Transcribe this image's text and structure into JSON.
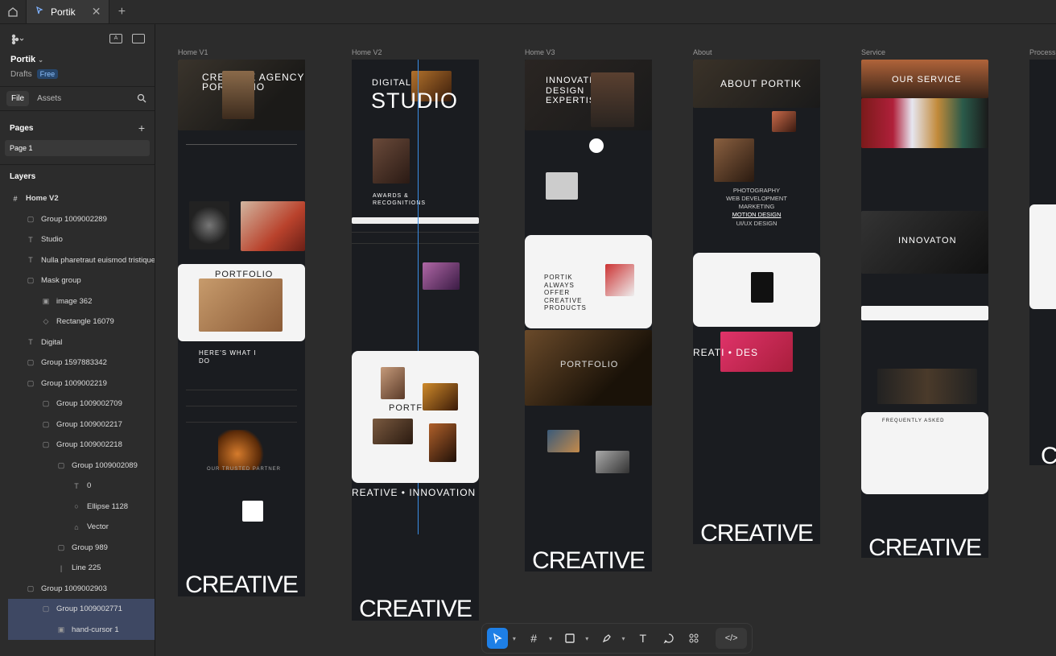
{
  "topbar": {
    "tab_title": "Portik"
  },
  "sidebar": {
    "file_name": "Portik",
    "drafts_label": "Drafts",
    "plan_badge": "Free",
    "tabs": {
      "file": "File",
      "assets": "Assets"
    },
    "pages_title": "Pages",
    "pages": [
      "Page 1"
    ],
    "layers_title": "Layers",
    "layers": [
      {
        "label": "Home V2",
        "icon": "frame-icon",
        "indent": 0
      },
      {
        "label": "Group 1009002289",
        "icon": "group-icon",
        "indent": 1
      },
      {
        "label": "Studio",
        "icon": "text-icon",
        "indent": 1
      },
      {
        "label": "Nulla pharetraut euismod tristique",
        "icon": "text-icon",
        "indent": 1
      },
      {
        "label": "Mask group",
        "icon": "group-icon",
        "indent": 1
      },
      {
        "label": "image 362",
        "icon": "image-icon",
        "indent": 2
      },
      {
        "label": "Rectangle 16079",
        "icon": "rectangle-icon",
        "indent": 2
      },
      {
        "label": "Digital",
        "icon": "text-icon",
        "indent": 1
      },
      {
        "label": "Group 1597883342",
        "icon": "group-icon",
        "indent": 1
      },
      {
        "label": "Group 1009002219",
        "icon": "group-icon",
        "indent": 1
      },
      {
        "label": "Group 1009002709",
        "icon": "group-icon",
        "indent": 2
      },
      {
        "label": "Group 1009002217",
        "icon": "group-icon",
        "indent": 2
      },
      {
        "label": "Group 1009002218",
        "icon": "group-icon",
        "indent": 2
      },
      {
        "label": "Group 1009002089",
        "icon": "group-icon",
        "indent": 3
      },
      {
        "label": "0",
        "icon": "text-icon",
        "indent": 4
      },
      {
        "label": "Ellipse 1128",
        "icon": "ellipse-icon",
        "indent": 4
      },
      {
        "label": "Vector",
        "icon": "vector-icon",
        "indent": 4
      },
      {
        "label": "Group 989",
        "icon": "group-icon",
        "indent": 3
      },
      {
        "label": "Line 225",
        "icon": "line-icon",
        "indent": 3
      },
      {
        "label": "Group 1009002903",
        "icon": "group-icon",
        "indent": 1
      },
      {
        "label": "Group 1009002771",
        "icon": "group-icon",
        "indent": 2,
        "selected": true
      },
      {
        "label": "hand-cursor 1",
        "icon": "image-icon",
        "indent": 3,
        "selected": true
      }
    ]
  },
  "canvas": {
    "frames": [
      {
        "label": "Home V1",
        "hero": "CREATIVE AGENCY PORTFOLIO",
        "card": "PORTFOLIO",
        "section": "HERE'S WHAT I DO",
        "trusted": "OUR TRUSTED PARTNER",
        "footer_word": "CREATIVE"
      },
      {
        "label": "Home V2",
        "hero": "STUDIO",
        "hero_top": "DIGITAL",
        "awards": "AWARDS & RECOGNITIONS",
        "card": "PORTFOLIO",
        "marquee": "REATIVE • INNOVATION • DESI",
        "footer_word": "CREATIVE"
      },
      {
        "label": "Home V3",
        "hero": "INNOVATIVE DESIGN EXPERTISE",
        "card": "PORTIK ALWAYS OFFER CREATIVE PRODUCTS",
        "mid": "PORTFOLIO",
        "footer_word": "CREATIVE"
      },
      {
        "label": "About",
        "hero": "ABOUT PORTIK",
        "skills": [
          "PHOTOGRAPHY",
          "WEB DEVELOPMENT",
          "MARKETING",
          "MOTION DESIGN",
          "UI/UX DESIGN"
        ],
        "marquee": "REATI • DES",
        "footer_word": "CREATIVE"
      },
      {
        "label": "Service",
        "hero": "OUR SERVICE",
        "mid": "INNOVATON",
        "card": "FREQUENTLY ASKED",
        "footer_word": "CREATIVE"
      },
      {
        "label": "Process",
        "footer_word": "C"
      }
    ]
  },
  "toolbar": {
    "tools": [
      "move-tool",
      "frame-tool",
      "rectangle-tool",
      "pen-tool",
      "text-tool",
      "comment-tool",
      "components-tool"
    ],
    "code_label": "</>"
  },
  "colors": {
    "accent": "#1e7fe6",
    "selection": "#3e4863",
    "canvas": "#2c2c2c",
    "frame_dark": "#1a1c20"
  }
}
